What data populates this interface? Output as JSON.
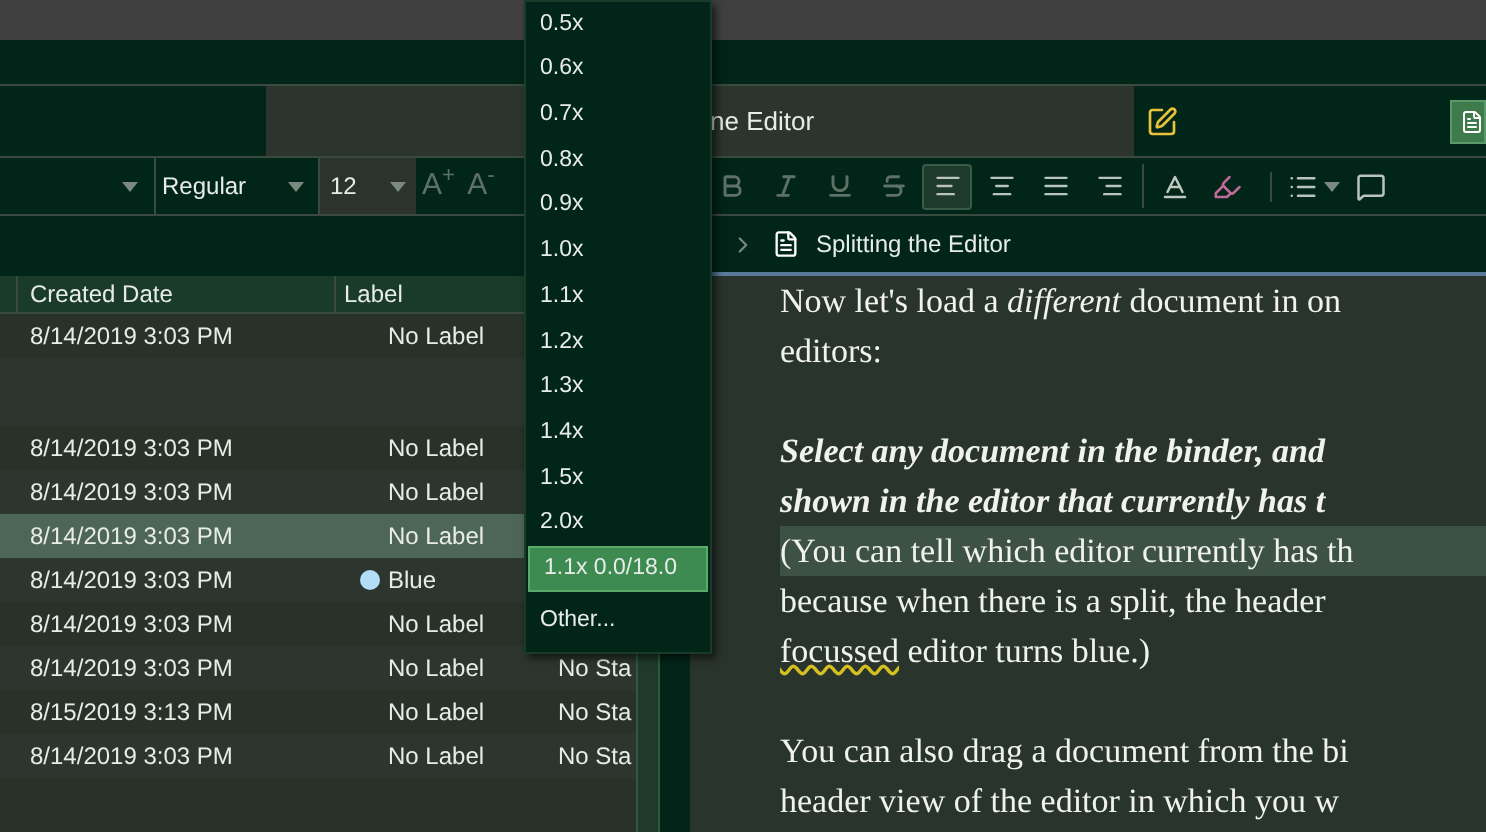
{
  "header": {
    "document_tab": "ne Editor"
  },
  "format_bar": {
    "style": "Regular",
    "size": "12",
    "size_buttons": [
      "A$^{+}$",
      "A$^{-}$"
    ],
    "style_buttons": [
      {
        "kind": "bold",
        "disabled": true
      },
      {
        "kind": "italic",
        "disabled": true
      },
      {
        "kind": "underline",
        "disabled": true
      },
      {
        "kind": "strike",
        "disabled": true
      }
    ],
    "align_buttons": [
      {
        "kind": "left",
        "selected": true
      },
      {
        "kind": "center",
        "selected": false
      },
      {
        "kind": "justify",
        "selected": false
      },
      {
        "kind": "right",
        "selected": false
      }
    ],
    "other_tools": [
      {
        "kind": "text-color"
      },
      {
        "kind": "highlight"
      },
      {
        "kind": "list"
      },
      {
        "kind": "comment"
      }
    ]
  },
  "zoom_menu": {
    "items": [
      {
        "label": "0.5x",
        "selected": false
      },
      {
        "label": "0.6x",
        "selected": false
      },
      {
        "label": "0.7x",
        "selected": false
      },
      {
        "label": "0.8x",
        "selected": false
      },
      {
        "label": "0.9x",
        "selected": false
      },
      {
        "label": "1.0x",
        "selected": false
      },
      {
        "label": "1.1x",
        "selected": false
      },
      {
        "label": "1.2x",
        "selected": false
      },
      {
        "label": "1.3x",
        "selected": false
      },
      {
        "label": "1.4x",
        "selected": false
      },
      {
        "label": "1.5x",
        "selected": false
      },
      {
        "label": "2.0x",
        "selected": false
      },
      {
        "label": "1.1x 0.0/18.0",
        "selected": true
      },
      {
        "label": "Other...",
        "selected": false
      }
    ]
  },
  "breadcrumb": {
    "title": "Splitting the Editor"
  },
  "table": {
    "columns": [
      "Created Date",
      "Label"
    ],
    "rows": [
      {
        "created": "8/14/2019 3:03 PM",
        "label": "No Label",
        "selected": false
      },
      {
        "selected": false
      },
      {
        "created": "8/14/2019 3:03 PM",
        "label": "No Label",
        "selected": false
      },
      {
        "created": "8/14/2019 3:03 PM",
        "label": "No Label",
        "selected": false
      },
      {
        "created": "8/14/2019 3:03 PM",
        "label": "No Label",
        "selected": true
      },
      {
        "created": "8/14/2019 3:03 PM",
        "label": "Blue",
        "color": "#b3dcf7",
        "selected": false
      },
      {
        "created": "8/14/2019 3:03 PM",
        "label": "No Label",
        "selected": false
      },
      {
        "created": "8/14/2019 3:03 PM",
        "label": "No Label",
        "column_3": "No Sta",
        "selected": false
      },
      {
        "created": "8/15/2019 3:13 PM",
        "label": "No Label",
        "column_3": "No Sta",
        "selected": false
      },
      {
        "created": "8/14/2019 3:03 PM",
        "label": "No Label",
        "column_3": "No Sta",
        "selected": false
      }
    ]
  },
  "editor": {
    "paragraphs": [
      {
        "lines": [
          {
            "text": "Now let's load a *different* document in on",
            "kind": "plain",
            "highlighted": false
          },
          {
            "text": "editors:",
            "kind": "plain",
            "highlighted": false
          }
        ]
      },
      {
        "lines": [
          {
            "text": "Select any document in the binder, and",
            "kind": "emphasis",
            "highlighted": false
          },
          {
            "text": "shown in the editor that currently has t",
            "kind": "emphasis",
            "highlighted": false
          },
          {
            "text": "(You can tell which editor currently has th",
            "kind": "plain",
            "highlighted": true
          },
          {
            "text": "because when there is a split, the header",
            "kind": "plain",
            "highlighted": false
          },
          {
            "segments": [
              {
                "text": "focussed",
                "misspelled": true
              },
              {
                "text": " editor turns blue.)",
                "misspelled": false
              }
            ],
            "kind": "plain",
            "highlighted": false
          }
        ]
      },
      {
        "lines": [
          {
            "text": "You can also drag a document from the bi",
            "kind": "plain",
            "highlighted": false
          },
          {
            "text": "header view of the editor in which you w",
            "kind": "plain",
            "highlighted": false
          }
        ]
      }
    ]
  }
}
